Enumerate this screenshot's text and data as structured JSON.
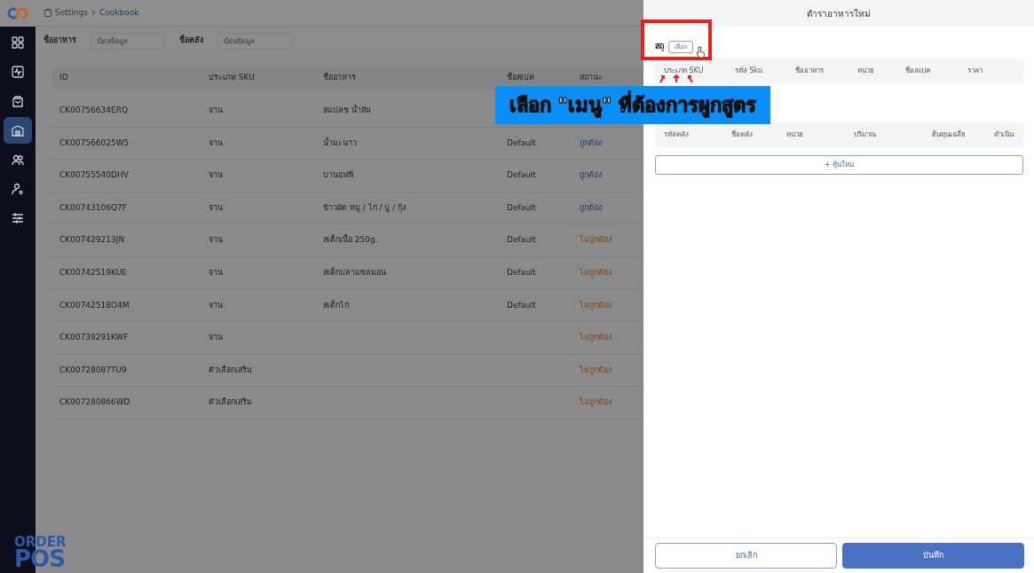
{
  "sidebar": {
    "items": [
      {
        "selected": false
      },
      {
        "selected": false
      },
      {
        "selected": false
      },
      {
        "selected": true
      },
      {
        "selected": false
      },
      {
        "selected": false
      },
      {
        "selected": false
      }
    ],
    "brand_top": "ORDER",
    "brand_bottom": "POS"
  },
  "breadcrumb": [
    "Settings",
    "Cookbook"
  ],
  "filters": [
    {
      "label": "ชื่ออาหาร",
      "placeholder": "ป้อนข้อมูล"
    },
    {
      "label": "ชื่อคลัง",
      "placeholder": "ป้อนข้อมูล"
    }
  ],
  "table": {
    "columns": [
      "ID",
      "ประเภท SKU",
      "ชื่ออาหาร",
      "ชื่อสเปค",
      "สถานะ"
    ],
    "rows": [
      {
        "id": "CK00756634ERQ",
        "sku_type": "จาน",
        "name": "สแปลช น้ำส้ม"
      },
      {
        "id": "CK007566025W5",
        "sku_type": "จาน",
        "name": "น้ำมะนาว",
        "spec": "Default",
        "status": "ถูกต้อง",
        "valid": true
      },
      {
        "id": "CK00755540DHV",
        "sku_type": "จาน",
        "name": "บานอฟฟี่",
        "spec": "Default",
        "status": "ถูกต้อง",
        "valid": true
      },
      {
        "id": "CK00743106Q7F",
        "sku_type": "จาน",
        "name": "ข้าวผัด หมู / ไก่ / ปู / กุ้ง",
        "spec": "Default",
        "status": "ถูกต้อง",
        "valid": true
      },
      {
        "id": "CK007429213JN",
        "sku_type": "จาน",
        "name": "สเต็กเนื้อ 250g.",
        "spec": "Default",
        "status": "ไม่ถูกต้อง",
        "valid": false
      },
      {
        "id": "CK00742519KUE",
        "sku_type": "จาน",
        "name": "สเต็กปลาแซลมอน",
        "spec": "Default",
        "status": "ไม่ถูกต้อง",
        "valid": false
      },
      {
        "id": "CK00742518O4M",
        "sku_type": "จาน",
        "name": "สเต็กไก่",
        "spec": "Default",
        "status": "ไม่ถูกต้อง",
        "valid": false
      },
      {
        "id": "CK00739291KWF",
        "sku_type": "จาน",
        "status": "ไม่ถูกต้อง",
        "valid": false
      },
      {
        "id": "CK00728087TU9",
        "sku_type": "ตัวเลือกเสริม",
        "status": "ไม่ถูกต้อง",
        "valid": false
      },
      {
        "id": "CK007280866WD",
        "sku_type": "ตัวเลือกเสริม",
        "status": "ไม่ถูกต้อง",
        "valid": false
      }
    ]
  },
  "panel": {
    "title": "ตำราอาหารใหม่",
    "field_label": "สถุ",
    "select_button": "เลือก",
    "sku_columns": [
      "ประเภท SKU",
      "รหัส Sku",
      "ชื่ออาหาร",
      "หน่วย",
      "ชื่อสเปค",
      "ราคา"
    ],
    "stock_columns": [
      "รหัสคลัง",
      "ชื่อคลัง",
      "หน่วย",
      "ปริมาณ",
      "ต้นทุนเฉลี่ย",
      "ดำเนิน"
    ],
    "add_button": "+ หุ้นใหม่",
    "cancel_button": "ยกเลิก",
    "save_button": "บันทึก"
  },
  "caption": "เลือก \"เมนู\" ที่ต้องการผูกสูตร"
}
